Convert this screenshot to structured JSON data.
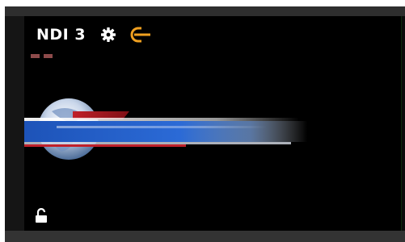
{
  "source": {
    "name": "NDI 3",
    "settings_icon": "gear-icon",
    "status_icon": "ndi-connected-icon",
    "status_color": "#f0a020",
    "tally_color": "#8d4a4a",
    "lock_icon": "lock-open-icon"
  },
  "preview": {
    "background": "#000000",
    "graphic": "lower-third-globe-banner"
  }
}
